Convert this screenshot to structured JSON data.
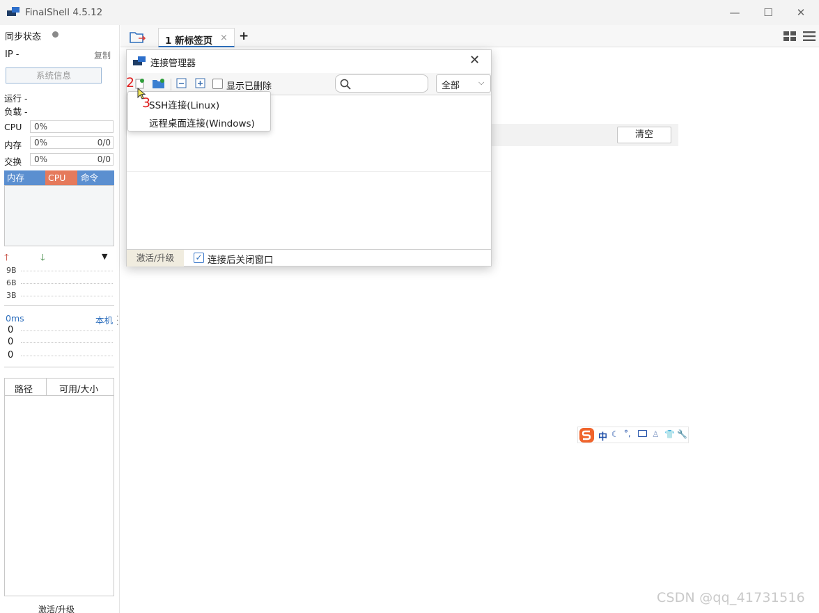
{
  "window": {
    "title": "FinalShell 4.5.12",
    "minimize": "—",
    "maximize": "☐",
    "close": "✕"
  },
  "sidebar": {
    "sync_label": "同步状态",
    "ip_label": "IP  -",
    "copy_label": "复制",
    "sysinfo_button": "系统信息",
    "run_label": "运行 -",
    "load_label": "负载 -",
    "stats": [
      {
        "label": "CPU",
        "pct": "0%",
        "value": ""
      },
      {
        "label": "内存",
        "pct": "0%",
        "value": "0/0"
      },
      {
        "label": "交换",
        "pct": "0%",
        "value": "0/0"
      }
    ],
    "proc_tabs": [
      "内存",
      "CPU",
      "命令"
    ],
    "net_scale": [
      "9B",
      "6B",
      "3B"
    ],
    "ping_label": "0ms",
    "local_label": "本机",
    "ping_values": [
      "0",
      "0",
      "0"
    ],
    "disk_columns": [
      "路径",
      "可用/大小"
    ],
    "activate_label": "激活/升级",
    "colors": {
      "tab_bg": "#5b8fd0",
      "cpu_tab": "#e57a5c",
      "link": "#2e6fbd"
    }
  },
  "tabs": {
    "items": [
      {
        "label": "1 新标签页",
        "close": "×"
      }
    ],
    "add": "+"
  },
  "main": {
    "clear_button": "清空",
    "ime_label": "中"
  },
  "dialog": {
    "title": "连接管理器",
    "close": "✕",
    "toolbar": {
      "show_deleted_label": "显示已删除",
      "search_placeholder": "",
      "filter_value": "全部",
      "filter_arrow": "⌵"
    },
    "footer": {
      "activate_label": "激活/升级",
      "close_after_connect_label": "连接后关闭窗口",
      "close_after_connect_checked": true,
      "check_mark": "✓"
    }
  },
  "popup_menu": {
    "items": [
      "SSH连接(Linux)",
      "远程桌面连接(Windows)"
    ]
  },
  "annotations": [
    "2",
    "3"
  ],
  "watermark": "CSDN @qq_41731516"
}
